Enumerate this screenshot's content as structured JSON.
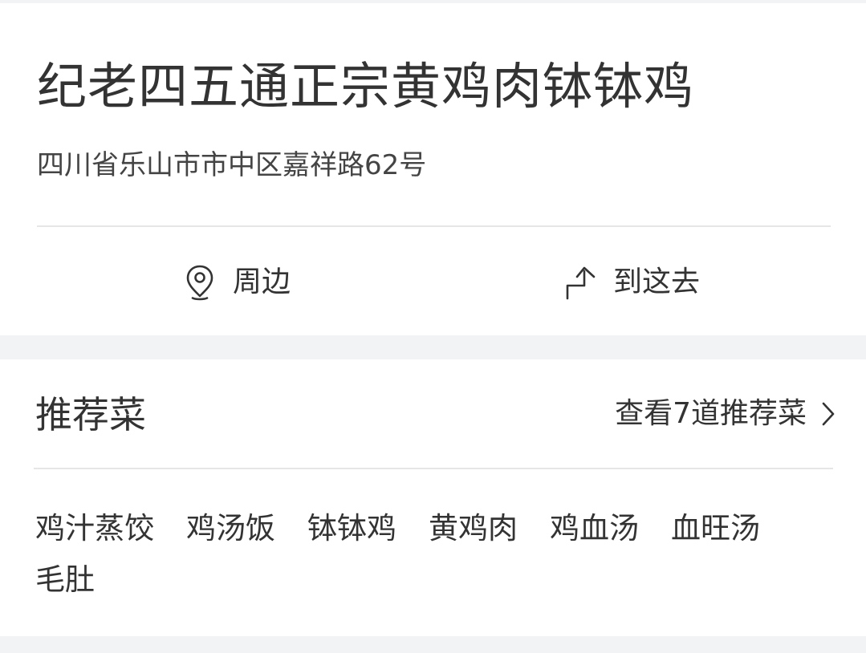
{
  "restaurant": {
    "name": "纪老四五通正宗黄鸡肉钵钵鸡",
    "address": "四川省乐山市市中区嘉祥路62号"
  },
  "actions": {
    "nearby": {
      "label": "周边",
      "icon": "location-pin-icon"
    },
    "directions": {
      "label": "到这去",
      "icon": "turn-arrow-icon"
    }
  },
  "recommended": {
    "title": "推荐菜",
    "view_all_label": "查看7道推荐菜",
    "dishes": [
      "鸡汁蒸饺",
      "鸡汤饭",
      "钵钵鸡",
      "黄鸡肉",
      "鸡血汤",
      "血旺汤",
      "毛肚"
    ]
  },
  "colors": {
    "background": "#f2f3f5",
    "card": "#ffffff",
    "text": "#333333",
    "divider": "#e6e6e6"
  }
}
